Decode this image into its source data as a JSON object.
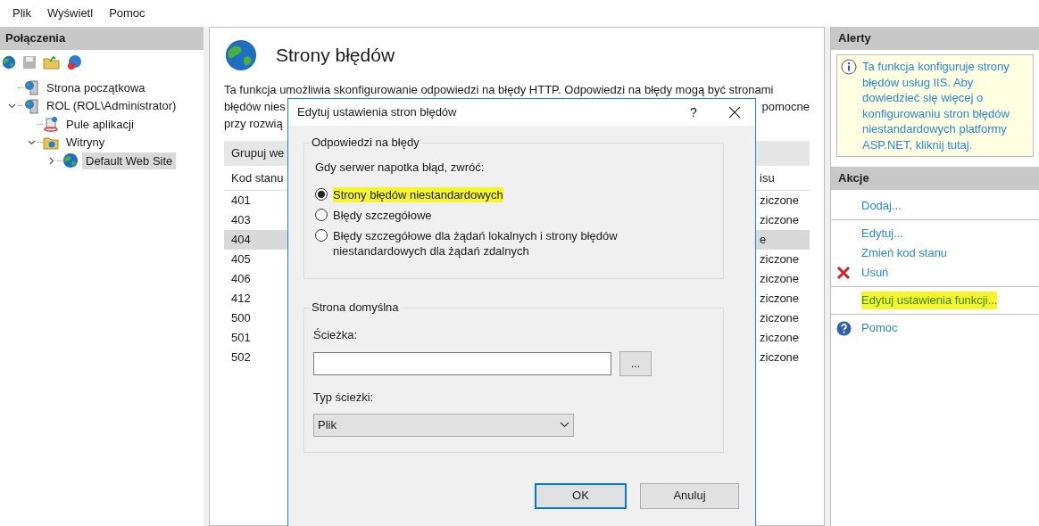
{
  "menu": [
    "Plik",
    "Wyświetl",
    "Pomoc"
  ],
  "connections": {
    "title": "Połączenia",
    "tree": [
      {
        "label": "Strona początkowa",
        "kind": "server",
        "selected": false
      },
      {
        "label": "ROL (ROL\\Administrator)",
        "kind": "server",
        "expanded": true,
        "selected": false,
        "children": [
          {
            "label": "Pule aplikacji",
            "kind": "pool",
            "selected": false
          },
          {
            "label": "Witryny",
            "kind": "folder",
            "expanded": true,
            "selected": false,
            "children": [
              {
                "label": "Default Web Site",
                "kind": "site",
                "expanded": false,
                "selected": true
              }
            ]
          }
        ]
      }
    ]
  },
  "page": {
    "title": "Strony błędów",
    "description": {
      "line_1": "Ta funkcja umożliwia skonfigurowanie odpowiedzi na błędy HTTP. Odpowiedzi na błędy mogą być stronami",
      "line_2_start": "błędów nies",
      "line_2_end": "pomocne",
      "line_3_start": "przy rozwią"
    },
    "group_by": "Grupuj we",
    "table": {
      "columns": [
        "Kod stanu",
        "isu"
      ],
      "rows": [
        {
          "code": "401",
          "column_2": "ziczone",
          "selected": false
        },
        {
          "code": "403",
          "column_2": "ziczone",
          "selected": false
        },
        {
          "code": "404",
          "column_2": "e",
          "selected": true
        },
        {
          "code": "405",
          "column_2": "ziczone",
          "selected": false
        },
        {
          "code": "406",
          "column_2": "ziczone",
          "selected": false
        },
        {
          "code": "412",
          "column_2": "ziczone",
          "selected": false
        },
        {
          "code": "500",
          "column_2": "ziczone",
          "selected": false
        },
        {
          "code": "501",
          "column_2": "ziczone",
          "selected": false
        },
        {
          "code": "502",
          "column_2": "ziczone",
          "selected": false
        }
      ]
    }
  },
  "alerts": {
    "title": "Alerty",
    "message": "Ta funkcja konfiguruje strony błędów usług IIS. Aby dowiedzieć się więcej o konfigurowaniu stron błędów niestandardowych platformy ASP.NET, kliknij tutaj."
  },
  "actions": {
    "title": "Akcje",
    "groups": [
      [
        {
          "label": "Dodaj...",
          "kind": "plain",
          "highlighted": false
        }
      ],
      [
        {
          "label": "Edytuj...",
          "kind": "plain",
          "highlighted": false
        },
        {
          "label": "Zmień kod stanu",
          "kind": "plain",
          "highlighted": false
        },
        {
          "label": "Usuń",
          "kind": "delete",
          "highlighted": false
        }
      ],
      [
        {
          "label": "Edytuj ustawienia funkcji...",
          "kind": "plain",
          "highlighted": true
        }
      ],
      [
        {
          "label": "Pomoc",
          "kind": "help",
          "highlighted": false
        }
      ]
    ]
  },
  "dialog": {
    "title": "Edytuj ustawienia stron błędów",
    "help": "?",
    "responses": {
      "legend": "Odpowiedzi na błędy",
      "prompt": "Gdy serwer napotka błąd, zwróć:",
      "options": [
        {
          "label": "Strony błędów niestandardowych",
          "selected": true,
          "highlighted": true
        },
        {
          "label": "Błędy szczegółowe",
          "selected": false,
          "highlighted": false
        },
        {
          "label": "Błędy szczegółowe dla żądań lokalnych i strony błędów niestandardowych dla żądań zdalnych",
          "selected": false,
          "highlighted": false
        }
      ]
    },
    "default_page": {
      "legend": "Strona domyślna",
      "path_label": "Ścieżka:",
      "browse": "...",
      "path_type_label": "Typ ścieżki:",
      "path_type": "Plik"
    },
    "buttons": [
      {
        "label": "OK",
        "default": true
      },
      {
        "label": "Anuluj",
        "default": false
      }
    ]
  }
}
